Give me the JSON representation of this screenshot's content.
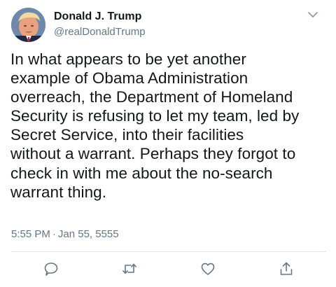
{
  "author": {
    "display_name": "Donald J. Trump",
    "handle": "@realDonaldTrump",
    "avatar_icon": "profile-photo"
  },
  "tweet": {
    "text": "In what appears to be yet another\nexample of Obama Administration\noverreach, the Department of Homeland\nSecurity is refusing to let my team, led by\nSecret Service, into their facilities\nwithout a warrant. Perhaps they forgot to\ncheck in with me about the no-search\nwarrant thing.",
    "time": "5:55 PM",
    "separator": "·",
    "date": "Jan 55, 5555"
  },
  "menu_icon": "chevron-down-icon",
  "actions": [
    {
      "icon": "reply-icon"
    },
    {
      "icon": "retweet-icon"
    },
    {
      "icon": "like-icon"
    },
    {
      "icon": "share-icon"
    }
  ],
  "colors": {
    "text_primary": "#14171a",
    "text_secondary": "#657786",
    "divider": "#e1e8ed",
    "icon": "#657786"
  }
}
